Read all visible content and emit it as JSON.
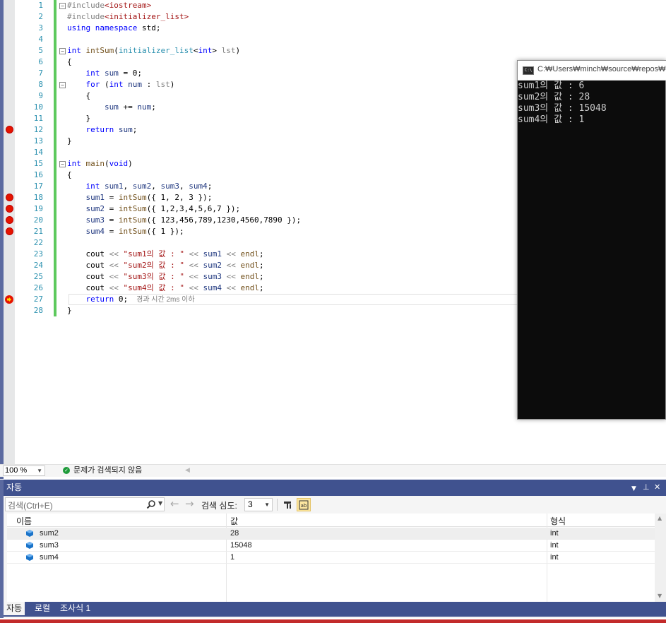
{
  "editor": {
    "lines": [
      {
        "num": "1",
        "code": [
          [
            "p",
            "#include"
          ],
          [
            "s",
            "<iostream>"
          ]
        ],
        "fold": "−"
      },
      {
        "num": "2",
        "code": [
          [
            "p",
            "#include"
          ],
          [
            "s",
            "<initializer_list>"
          ]
        ]
      },
      {
        "num": "3",
        "code": [
          [
            "k",
            "using"
          ],
          [
            "n",
            " "
          ],
          [
            "k",
            "namespace"
          ],
          [
            "n",
            " std;"
          ]
        ]
      },
      {
        "num": "4",
        "code": []
      },
      {
        "num": "5",
        "code": [
          [
            "k",
            "int"
          ],
          [
            "n",
            " "
          ],
          [
            "f",
            "intSum"
          ],
          [
            "n",
            "("
          ],
          [
            "t",
            "initializer_list"
          ],
          [
            "n",
            "<"
          ],
          [
            "k",
            "int"
          ],
          [
            "n",
            "> "
          ],
          [
            "p",
            "lst"
          ],
          [
            "n",
            ")"
          ]
        ],
        "fold": "−"
      },
      {
        "num": "6",
        "code": [
          [
            "n",
            "{"
          ]
        ]
      },
      {
        "num": "7",
        "code": [
          [
            "n",
            "    "
          ],
          [
            "k",
            "int"
          ],
          [
            "n",
            " "
          ],
          [
            "v",
            "sum"
          ],
          [
            "n",
            " = 0;"
          ]
        ]
      },
      {
        "num": "8",
        "code": [
          [
            "n",
            "    "
          ],
          [
            "k",
            "for"
          ],
          [
            "n",
            " ("
          ],
          [
            "k",
            "int"
          ],
          [
            "n",
            " "
          ],
          [
            "v",
            "num"
          ],
          [
            "n",
            " : "
          ],
          [
            "p",
            "lst"
          ],
          [
            "n",
            ")"
          ]
        ],
        "fold": "−"
      },
      {
        "num": "9",
        "code": [
          [
            "n",
            "    {"
          ]
        ]
      },
      {
        "num": "10",
        "code": [
          [
            "n",
            "        "
          ],
          [
            "v",
            "sum"
          ],
          [
            "n",
            " += "
          ],
          [
            "v",
            "num"
          ],
          [
            "n",
            ";"
          ]
        ]
      },
      {
        "num": "11",
        "code": [
          [
            "n",
            "    }"
          ]
        ]
      },
      {
        "num": "12",
        "code": [
          [
            "n",
            "    "
          ],
          [
            "k",
            "return"
          ],
          [
            "n",
            " "
          ],
          [
            "v",
            "sum"
          ],
          [
            "n",
            ";"
          ]
        ],
        "bp": true
      },
      {
        "num": "13",
        "code": [
          [
            "n",
            "}"
          ]
        ]
      },
      {
        "num": "14",
        "code": []
      },
      {
        "num": "15",
        "code": [
          [
            "k",
            "int"
          ],
          [
            "n",
            " "
          ],
          [
            "f",
            "main"
          ],
          [
            "n",
            "("
          ],
          [
            "k",
            "void"
          ],
          [
            "n",
            ")"
          ]
        ],
        "fold": "−"
      },
      {
        "num": "16",
        "code": [
          [
            "n",
            "{"
          ]
        ]
      },
      {
        "num": "17",
        "code": [
          [
            "n",
            "    "
          ],
          [
            "k",
            "int"
          ],
          [
            "n",
            " "
          ],
          [
            "v",
            "sum1"
          ],
          [
            "n",
            ", "
          ],
          [
            "v",
            "sum2"
          ],
          [
            "n",
            ", "
          ],
          [
            "v",
            "sum3"
          ],
          [
            "n",
            ", "
          ],
          [
            "v",
            "sum4"
          ],
          [
            "n",
            ";"
          ]
        ]
      },
      {
        "num": "18",
        "code": [
          [
            "n",
            "    "
          ],
          [
            "v",
            "sum1"
          ],
          [
            "n",
            " = "
          ],
          [
            "f",
            "intSum"
          ],
          [
            "n",
            "({ 1, 2, 3 });"
          ]
        ],
        "bp": true
      },
      {
        "num": "19",
        "code": [
          [
            "n",
            "    "
          ],
          [
            "v",
            "sum2"
          ],
          [
            "n",
            " = "
          ],
          [
            "f",
            "intSum"
          ],
          [
            "n",
            "({ 1,2,3,4,5,6,7 });"
          ]
        ],
        "bp": true
      },
      {
        "num": "20",
        "code": [
          [
            "n",
            "    "
          ],
          [
            "v",
            "sum3"
          ],
          [
            "n",
            " = "
          ],
          [
            "f",
            "intSum"
          ],
          [
            "n",
            "({ 123,456,789,1230,4560,7890 });"
          ]
        ],
        "bp": true
      },
      {
        "num": "21",
        "code": [
          [
            "n",
            "    "
          ],
          [
            "v",
            "sum4"
          ],
          [
            "n",
            " = "
          ],
          [
            "f",
            "intSum"
          ],
          [
            "n",
            "({ 1 });"
          ]
        ],
        "bp": true
      },
      {
        "num": "22",
        "code": []
      },
      {
        "num": "23",
        "code": [
          [
            "n",
            "    cout "
          ],
          [
            "p",
            "<<"
          ],
          [
            "n",
            " "
          ],
          [
            "s",
            "\"sum1의 값 : \""
          ],
          [
            "n",
            " "
          ],
          [
            "p",
            "<<"
          ],
          [
            "n",
            " "
          ],
          [
            "v",
            "sum1"
          ],
          [
            "n",
            " "
          ],
          [
            "p",
            "<<"
          ],
          [
            "n",
            " "
          ],
          [
            "f",
            "endl"
          ],
          [
            "n",
            ";"
          ]
        ]
      },
      {
        "num": "24",
        "code": [
          [
            "n",
            "    cout "
          ],
          [
            "p",
            "<<"
          ],
          [
            "n",
            " "
          ],
          [
            "s",
            "\"sum2의 값 : \""
          ],
          [
            "n",
            " "
          ],
          [
            "p",
            "<<"
          ],
          [
            "n",
            " "
          ],
          [
            "v",
            "sum2"
          ],
          [
            "n",
            " "
          ],
          [
            "p",
            "<<"
          ],
          [
            "n",
            " "
          ],
          [
            "f",
            "endl"
          ],
          [
            "n",
            ";"
          ]
        ]
      },
      {
        "num": "25",
        "code": [
          [
            "n",
            "    cout "
          ],
          [
            "p",
            "<<"
          ],
          [
            "n",
            " "
          ],
          [
            "s",
            "\"sum3의 값 : \""
          ],
          [
            "n",
            " "
          ],
          [
            "p",
            "<<"
          ],
          [
            "n",
            " "
          ],
          [
            "v",
            "sum3"
          ],
          [
            "n",
            " "
          ],
          [
            "p",
            "<<"
          ],
          [
            "n",
            " "
          ],
          [
            "f",
            "endl"
          ],
          [
            "n",
            ";"
          ]
        ]
      },
      {
        "num": "26",
        "code": [
          [
            "n",
            "    cout "
          ],
          [
            "p",
            "<<"
          ],
          [
            "n",
            " "
          ],
          [
            "s",
            "\"sum4의 값 : \""
          ],
          [
            "n",
            " "
          ],
          [
            "p",
            "<<"
          ],
          [
            "n",
            " "
          ],
          [
            "v",
            "sum4"
          ],
          [
            "n",
            " "
          ],
          [
            "p",
            "<<"
          ],
          [
            "n",
            " "
          ],
          [
            "f",
            "endl"
          ],
          [
            "n",
            ";"
          ]
        ]
      },
      {
        "num": "27",
        "code": [
          [
            "n",
            "    "
          ],
          [
            "k",
            "return"
          ],
          [
            "n",
            " 0;"
          ]
        ],
        "current": true,
        "hint": "경과 시간 2ms 이하"
      },
      {
        "num": "28",
        "code": [
          [
            "n",
            "}"
          ]
        ]
      }
    ]
  },
  "console": {
    "icon_label": "C:\\",
    "title": "C:₩Users₩minch₩source₩repos₩",
    "lines": [
      "sum1의 값 : 6",
      "sum2의 값 : 28",
      "sum3의 값 : 15048",
      "sum4의 값 : 1"
    ]
  },
  "status": {
    "zoom": "100 %",
    "message": "문제가 검색되지 않음"
  },
  "autos": {
    "title": "자동",
    "search_placeholder": "검색(Ctrl+E)",
    "depth_label": "검색 심도:",
    "depth_value": "3",
    "columns": {
      "name": "이름",
      "value": "값",
      "type": "형식"
    },
    "rows": [
      {
        "name": "sum2",
        "value": "28",
        "type": "int",
        "selected": true
      },
      {
        "name": "sum3",
        "value": "15048",
        "type": "int"
      },
      {
        "name": "sum4",
        "value": "1",
        "type": "int"
      }
    ],
    "tabs": [
      {
        "label": "자동",
        "active": true
      },
      {
        "label": "로컬"
      },
      {
        "label": "조사식 1"
      }
    ]
  },
  "colors": {
    "frame": "#5b6aa0",
    "panel_header": "#40528f",
    "breakpoint": "#e51400",
    "change_bar": "#5dc95d",
    "console_bg": "#0c0c0c"
  }
}
